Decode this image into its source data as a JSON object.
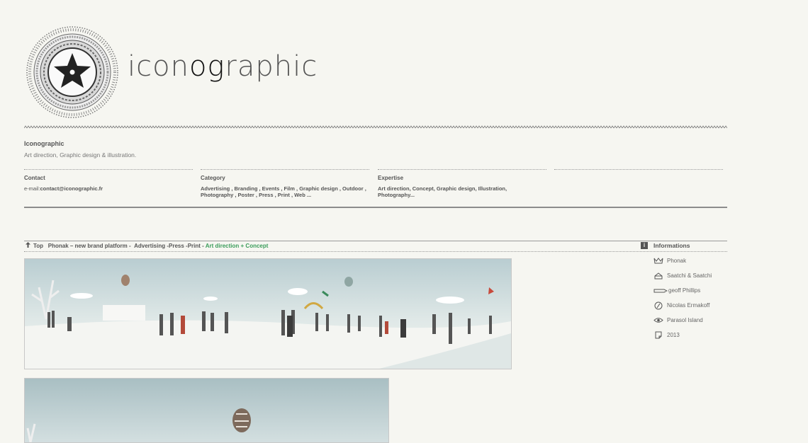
{
  "brand": {
    "wordmark_pre": "icon",
    "wordmark_og": "og",
    "wordmark_post": "raphic",
    "name": "Iconographic",
    "tagline": "Art direction, Graphic design & illustration."
  },
  "columns": {
    "contact": {
      "title": "Contact",
      "label": "e-mail:",
      "email": "contact@iconographic.fr"
    },
    "category": {
      "title": "Category",
      "text": "Advertising , Branding , Events , Film , Graphic design , Outdoor , Photography , Poster , Press , Print , Web ..."
    },
    "expertise": {
      "title": "Expertise",
      "text": "Art direction, Concept, Graphic design, Illustration, Photography..."
    }
  },
  "project_bar": {
    "top_label": "Top",
    "project": "Phonak – new brand platform -",
    "categories": "Advertising -Press -Print -",
    "expertise": "Art direction + Concept"
  },
  "informations": {
    "icon_letter": "i",
    "title": "Informations",
    "client": "Phonak",
    "agency": "Saatchi & Saatchi",
    "creative": "geoff Phillips",
    "photographer": "Nicolas Ermakoff",
    "production": "Parasol Island",
    "year": "2013"
  },
  "colors": {
    "background": "#f6f6f1",
    "text": "#555555",
    "accent_green": "#3a9c5a"
  }
}
